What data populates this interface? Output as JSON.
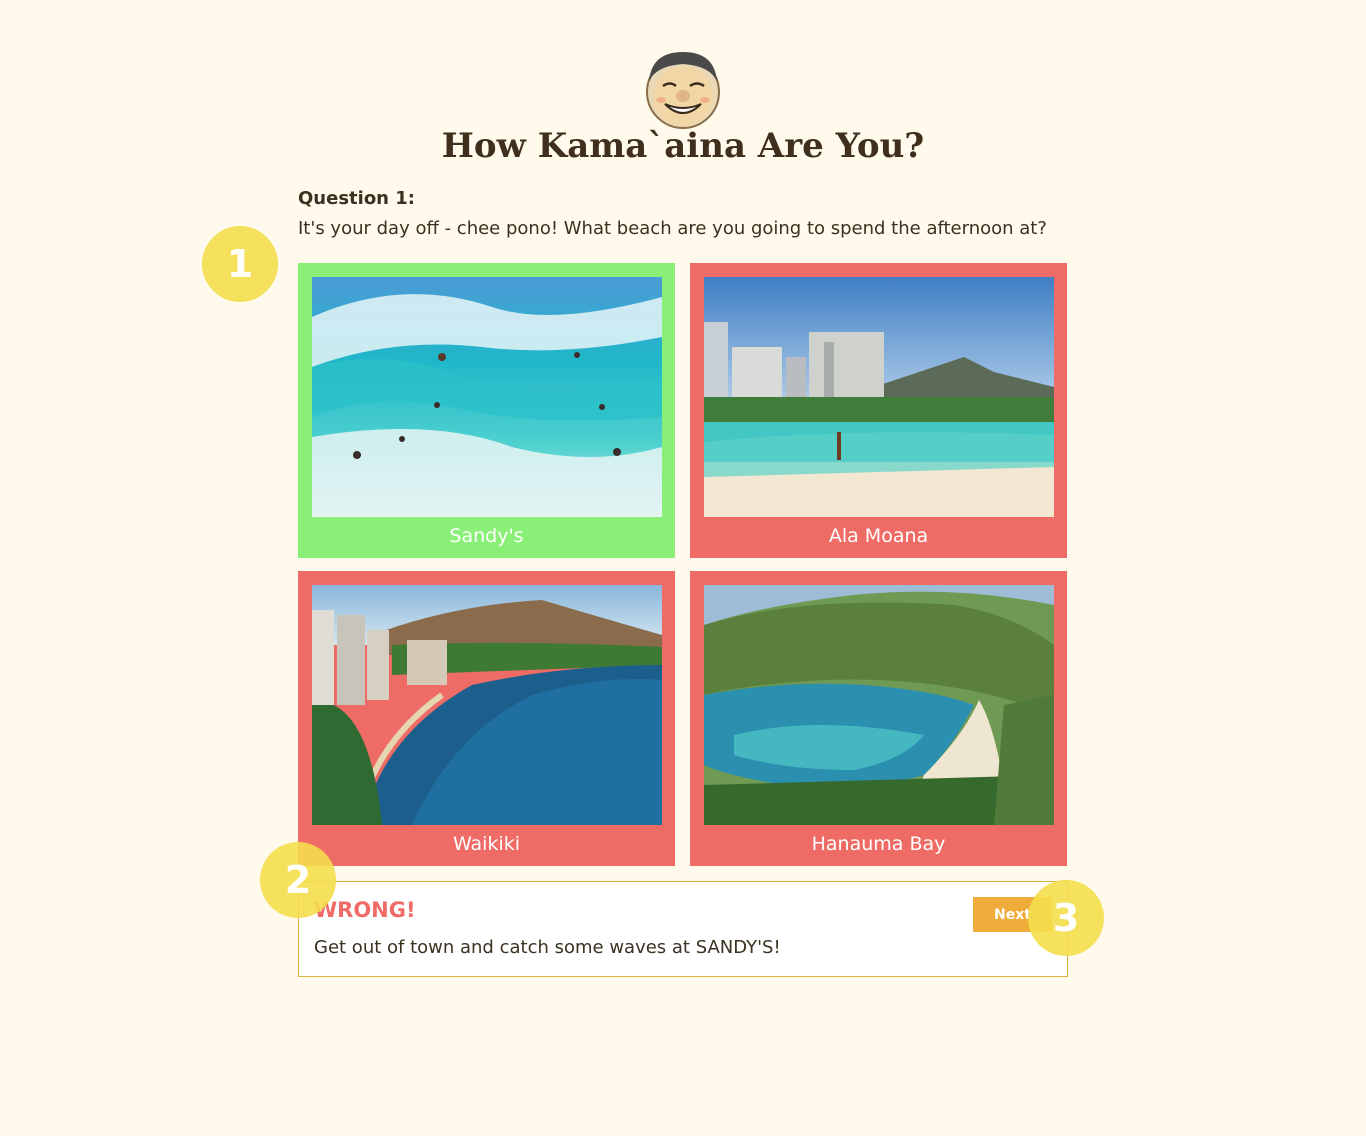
{
  "header": {
    "title": "How Kama`aina Are You?",
    "logo": "smiling-face-logo"
  },
  "question": {
    "number_label": "Question 1:",
    "text": "It's your day off - chee pono! What beach are you going to spend the afternoon at?"
  },
  "answers": [
    {
      "label": "Sandy's",
      "state": "correct",
      "image": "surf-waves-photo",
      "color": "#89ef77"
    },
    {
      "label": "Ala Moana",
      "state": "wrong",
      "image": "ala-moana-beach-photo",
      "color": "#ee6b66"
    },
    {
      "label": "Waikiki",
      "state": "wrong",
      "image": "waikiki-coastline-photo",
      "color": "#ee6b66"
    },
    {
      "label": "Hanauma Bay",
      "state": "wrong",
      "image": "hanauma-bay-photo",
      "color": "#ee6b66"
    }
  ],
  "feedback": {
    "heading": "WRONG!",
    "message": "Get out of town and catch some waves at SANDY'S!",
    "next_label": "Next"
  },
  "markers": [
    "1",
    "2",
    "3"
  ],
  "colors": {
    "background": "#fffaec",
    "correct": "#89ef77",
    "wrong": "#ee6b66",
    "button": "#f0ac3a",
    "marker": "#f4de4c"
  }
}
